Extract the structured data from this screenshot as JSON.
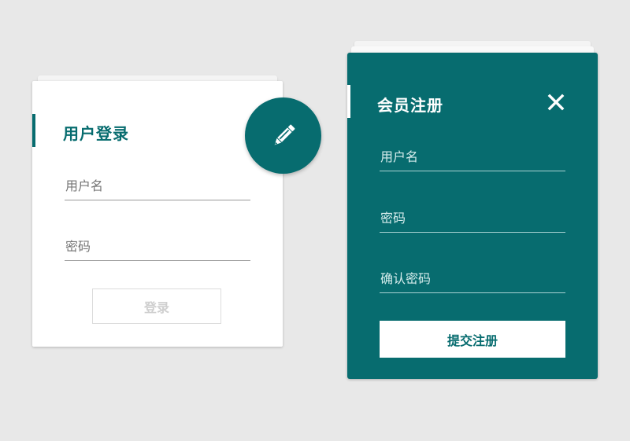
{
  "login": {
    "title": "用户登录",
    "username_label": "用户名",
    "password_label": "密码",
    "submit_label": "登录"
  },
  "fab": {
    "icon": "pencil-icon"
  },
  "register": {
    "title": "会员注册",
    "close_icon": "close-icon",
    "username_label": "用户名",
    "password_label": "密码",
    "confirm_label": "确认密码",
    "submit_label": "提交注册"
  },
  "colors": {
    "accent": "#076c6f",
    "background": "#e8e8e8",
    "card": "#ffffff"
  }
}
